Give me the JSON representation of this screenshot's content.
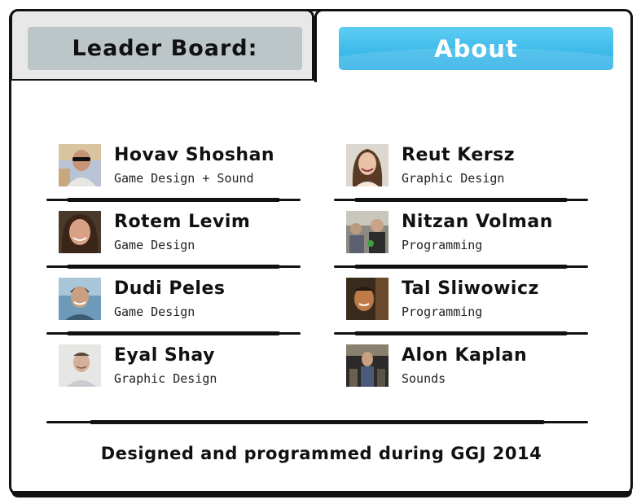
{
  "tabs": {
    "leaderboard_label": "Leader Board:",
    "about_label": "About"
  },
  "credits": [
    {
      "name": "Hovav Shoshan",
      "role": "Game Design + Sound",
      "avatar": "man-sunglasses-avatar"
    },
    {
      "name": "Reut Kersz",
      "role": "Graphic Design",
      "avatar": "woman-smiling-avatar"
    },
    {
      "name": "Rotem Levim",
      "role": "Game Design",
      "avatar": "woman-portrait-avatar"
    },
    {
      "name": "Nitzan Volman",
      "role": "Programming",
      "avatar": "man-crowd-avatar"
    },
    {
      "name": "Dudi Peles",
      "role": "Game Design",
      "avatar": "man-outdoor-avatar"
    },
    {
      "name": "Tal Sliwowicz",
      "role": "Programming",
      "avatar": "man-dim-avatar"
    },
    {
      "name": "Eyal Shay",
      "role": "Graphic Design",
      "avatar": "man-light-avatar"
    },
    {
      "name": "Alon Kaplan",
      "role": "Sounds",
      "avatar": "man-event-avatar"
    }
  ],
  "footer": "Designed and programmed during GGJ 2014",
  "colors": {
    "about_button": "#3fbbea",
    "leaderboard_button": "#bcc6c9",
    "leaderboard_tab": "#e8e8e8",
    "outline": "#111111"
  }
}
